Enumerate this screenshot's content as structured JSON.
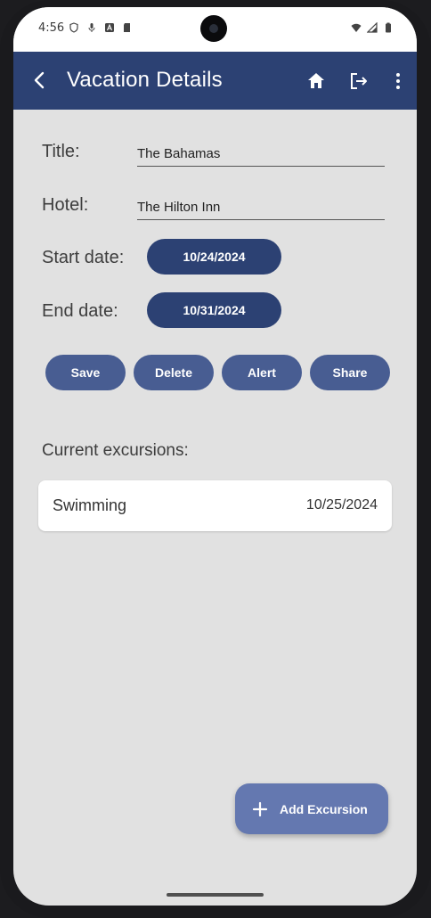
{
  "status_bar": {
    "time": "4:56",
    "left_icons": [
      "shield-icon",
      "mic-icon",
      "font-icon",
      "sd-card-icon"
    ],
    "right_icons": [
      "wifi-icon",
      "cellular-icon",
      "battery-icon"
    ]
  },
  "app_bar": {
    "title": "Vacation Details",
    "color": "#2c4173",
    "actions": [
      "home-icon",
      "logout-icon",
      "more-vert-icon"
    ]
  },
  "form": {
    "title_label": "Title:",
    "title_value": "The Bahamas",
    "hotel_label": "Hotel:",
    "hotel_value": "The Hilton Inn",
    "start_label": "Start date:",
    "start_value": "10/24/2024",
    "end_label": "End date:",
    "end_value": "10/31/2024"
  },
  "actions": {
    "save": "Save",
    "delete": "Delete",
    "alert": "Alert",
    "share": "Share"
  },
  "excursions": {
    "heading": "Current excursions:",
    "items": [
      {
        "title": "Swimming",
        "date": "10/25/2024"
      }
    ]
  },
  "fab": {
    "label": "Add Excursion",
    "color": "#6478b0"
  }
}
